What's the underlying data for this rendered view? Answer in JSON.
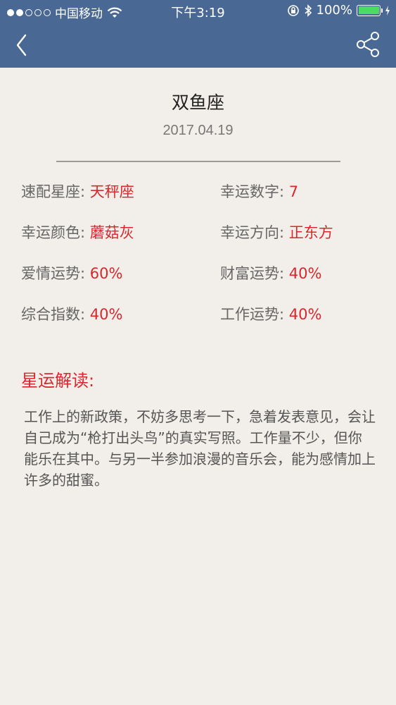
{
  "status_bar": {
    "carrier": "中国移动",
    "time": "下午3:19",
    "battery": "100%",
    "signal_bars_filled": 2,
    "signal_bars_total": 5
  },
  "nav": {
    "back_icon": "chevron-left-icon",
    "share_icon": "share-icon",
    "bar_color": "#4a6894"
  },
  "sign": {
    "name": "双鱼座",
    "date": "2017.04.19"
  },
  "stats": [
    {
      "label": "速配星座: ",
      "value": "天秤座"
    },
    {
      "label": "幸运数字: ",
      "value": "7"
    },
    {
      "label": "幸运颜色: ",
      "value": "蘑菇灰"
    },
    {
      "label": "幸运方向: ",
      "value": "正东方"
    },
    {
      "label": "爱情运势: ",
      "value": "60%"
    },
    {
      "label": "财富运势: ",
      "value": "40%"
    },
    {
      "label": "综合指数: ",
      "value": "40%"
    },
    {
      "label": "工作运势: ",
      "value": "40%"
    }
  ],
  "reading": {
    "title": "星运解读:",
    "text": "工作上的新政策，不妨多思考一下，急着发表意见，会让自己成为“枪打出头鸟”的真实写照。工作量不少，但你能乐在其中。与另一半参加浪漫的音乐会，能为感情加上许多的甜蜜。"
  },
  "colors": {
    "accent": "#d9272e",
    "background": "#f2efea"
  }
}
